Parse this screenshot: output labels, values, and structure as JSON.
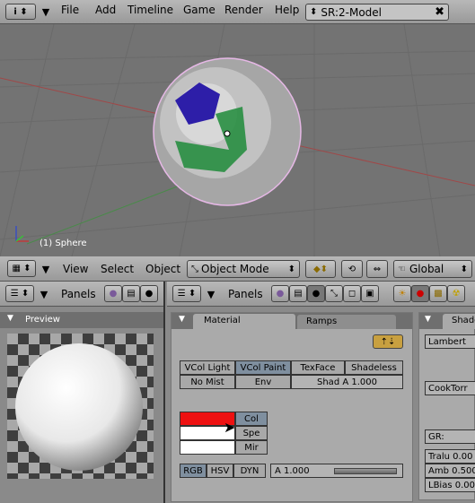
{
  "topbar": {
    "menus": [
      "File",
      "Add",
      "Timeline",
      "Game",
      "Render",
      "Help"
    ],
    "scene_field": "SR:2-Model"
  },
  "viewport": {
    "object_label": "(1) Sphere"
  },
  "view3d_header": {
    "menus": [
      "View",
      "Select",
      "Object"
    ],
    "mode": "Object Mode",
    "pivot": "Global"
  },
  "left_panel": {
    "header": "Panels",
    "tab": "Preview"
  },
  "mid_panel": {
    "header": "Panels",
    "tab_material": "Material",
    "tab_ramps": "Ramps",
    "row1": [
      "VCol Light",
      "VCol Paint",
      "TexFace",
      "Shadeless"
    ],
    "row2": [
      "No Mist",
      "Env",
      "Shad A 1.000"
    ],
    "color_buttons": [
      "Col",
      "Spe",
      "Mir"
    ],
    "mode_buttons": [
      "RGB",
      "HSV",
      "DYN"
    ],
    "alpha": "A 1.000"
  },
  "right_panel": {
    "tab": "Shade",
    "diffuse": "Lambert",
    "specular": "CookTorr",
    "gr": "GR:",
    "tralu": "Tralu 0.00",
    "amb": "Amb 0.500",
    "lbias": "LBias 0.00"
  },
  "colors": {
    "col": "#ee1111",
    "spe": "#ffffff",
    "mir": "#ffffff"
  }
}
